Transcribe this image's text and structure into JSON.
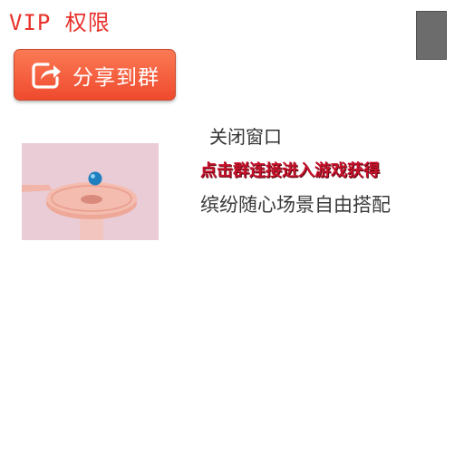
{
  "header": {
    "title": "VIP 权限"
  },
  "share_button": {
    "label": "分享到群",
    "icon": "share-icon"
  },
  "popup": {
    "close_label": "关闭窗口",
    "promo": "点击群连接进入游戏获得",
    "description": "缤纷随心场景自由搭配"
  },
  "preview": {
    "subject": "ball on pink helix platform"
  },
  "colors": {
    "title": "#e8312a",
    "button_top": "#fb7a55",
    "button_bottom": "#ef4a2e",
    "promo": "#c7102a",
    "preview_bg": "#eaccd6",
    "platform": "#f1b1a6",
    "ball": "#1f7fbf"
  }
}
